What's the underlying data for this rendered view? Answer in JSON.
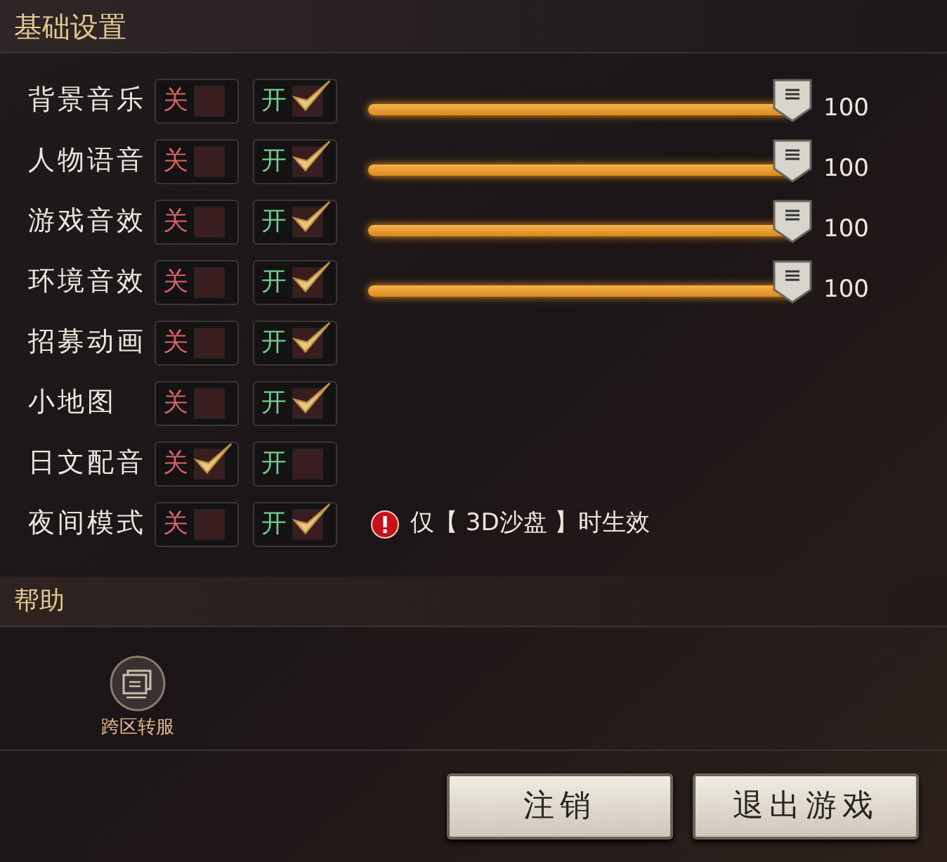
{
  "basic_settings": {
    "title": "基础设置",
    "rows": [
      {
        "kind": "slider",
        "label": "背景音乐",
        "options": [
          {
            "label": "关",
            "selected": false
          },
          {
            "label": "开",
            "selected": true
          }
        ],
        "level": 1,
        "reading": "100"
      },
      {
        "kind": "slider",
        "label": "人物语音",
        "options": [
          {
            "label": "关",
            "selected": false
          },
          {
            "label": "开",
            "selected": true
          }
        ],
        "level": 1,
        "reading": "100"
      },
      {
        "kind": "slider",
        "label": "游戏音效",
        "options": [
          {
            "label": "关",
            "selected": false
          },
          {
            "label": "开",
            "selected": true
          }
        ],
        "level": 1,
        "reading": "100"
      },
      {
        "kind": "slider",
        "label": "环境音效",
        "options": [
          {
            "label": "关",
            "selected": false
          },
          {
            "label": "开",
            "selected": true
          }
        ],
        "level": 1,
        "reading": "100"
      },
      {
        "kind": "toggle",
        "label": "招募动画",
        "options": [
          {
            "label": "关",
            "selected": false
          },
          {
            "label": "开",
            "selected": true
          }
        ]
      },
      {
        "kind": "toggle",
        "label": "小地图",
        "options": [
          {
            "label": "关",
            "selected": false
          },
          {
            "label": "开",
            "selected": true
          }
        ]
      },
      {
        "kind": "toggle",
        "label": "日文配音",
        "options": [
          {
            "label": "关",
            "selected": true
          },
          {
            "label": "开",
            "selected": false
          }
        ]
      },
      {
        "kind": "note",
        "label": "夜间模式",
        "options": [
          {
            "label": "关",
            "selected": false
          },
          {
            "label": "开",
            "selected": true
          }
        ],
        "note": "仅【 3D沙盘 】时生效"
      }
    ]
  },
  "help": {
    "title": "帮助",
    "items": [
      {
        "label": "跨区转服"
      }
    ]
  },
  "buttons": [
    "注销",
    "退出游戏"
  ]
}
